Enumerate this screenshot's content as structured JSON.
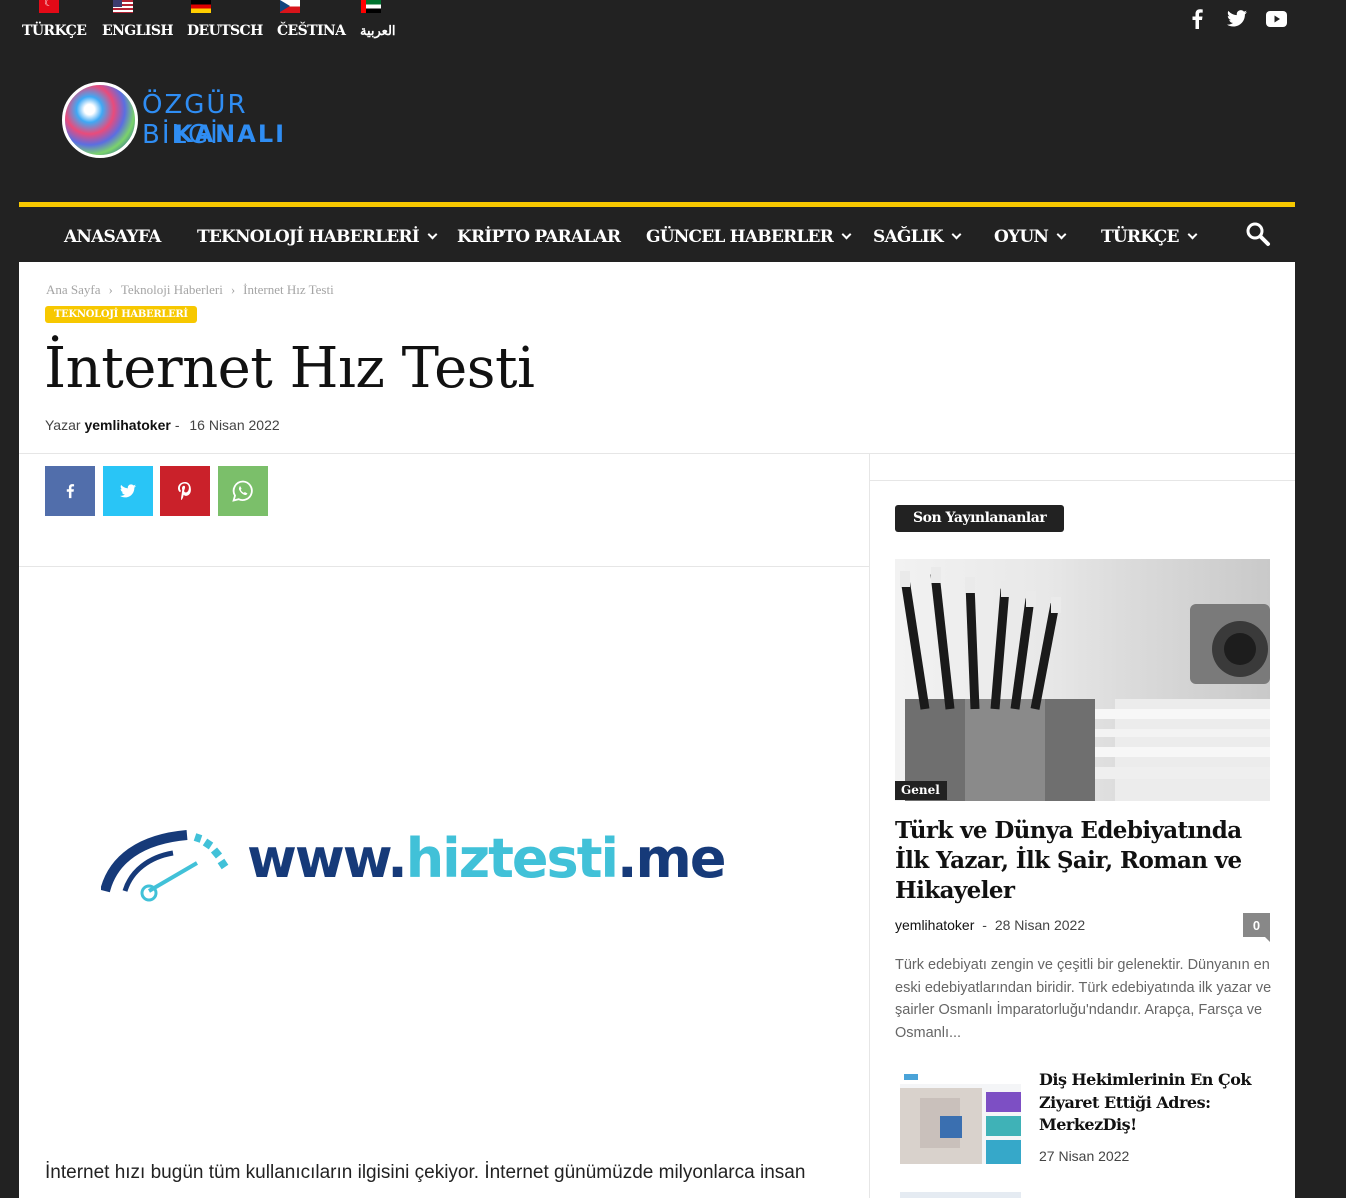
{
  "languages": [
    {
      "label": "TÜRKÇE",
      "flag": "tr-flag-icon"
    },
    {
      "label": "ENGLISH",
      "flag": "us-flag-icon"
    },
    {
      "label": "DEUTSCH",
      "flag": "de-flag-icon"
    },
    {
      "label": "ČEŠTINA",
      "flag": "cz-flag-icon"
    },
    {
      "label": "العربية",
      "flag": "ae-flag-icon"
    }
  ],
  "social": [
    "facebook-icon",
    "twitter-icon",
    "youtube-icon"
  ],
  "logo": {
    "line1": "ÖZGÜR BİLGİ",
    "line2": "KANALI"
  },
  "nav": [
    {
      "label": "ANASAYFA",
      "dropdown": false
    },
    {
      "label": "TEKNOLOJİ HABERLERİ",
      "dropdown": true
    },
    {
      "label": "KRİPTO PARALAR",
      "dropdown": false
    },
    {
      "label": "GÜNCEL HABERLER",
      "dropdown": true
    },
    {
      "label": "SAĞLIK",
      "dropdown": true
    },
    {
      "label": "OYUN",
      "dropdown": true
    },
    {
      "label": "TÜRKÇE",
      "dropdown": true
    }
  ],
  "breadcrumb": [
    "Ana Sayfa",
    "Teknoloji Haberleri",
    "İnternet Hız Testi"
  ],
  "breadcrumb_sep": "›",
  "article": {
    "category": "TEKNOLOJİ HABERLERİ",
    "title": "İnternet Hız Testi",
    "by": "Yazar",
    "author": "yemlihatoker",
    "dash": "-",
    "date": "16 Nisan 2022",
    "hero_url_a": "www.",
    "hero_url_b": "hiztesti",
    "hero_url_c": ".me",
    "lead": "İnternet hızı bugün tüm kullanıcıların ilgisini çekiyor. İnternet günümüzde milyonlarca insan"
  },
  "sidebar": {
    "title": "Son Yayınlananlar",
    "featured": {
      "category": "Genel",
      "title": "Türk ve Dünya Edebiyatında İlk Yazar, İlk Şair, Roman ve Hikayeler",
      "author": "yemlihatoker",
      "dash": "-",
      "date": "28 Nisan 2022",
      "comments": "0",
      "excerpt": "Türk edebiyatı zengin ve çeşitli bir gelenektir. Dünyanın en eski edebiyatlarından biridir. Türk edebiyatında ilk yazar ve şairler Osmanlı İmparatorluğu'ndandır. Arapça, Farsça ve Osmanlı..."
    },
    "second": {
      "title": "Diş Hekimlerinin En Çok Ziyaret Ettiği Adres: MerkezDiş!",
      "date": "27 Nisan 2022"
    }
  },
  "colors": {
    "accent": "#f7c800",
    "dark": "#222222",
    "facebook": "#516eab",
    "twitter": "#29c5f6",
    "pinterest": "#ca212a",
    "whatsapp": "#7bbf6a"
  }
}
